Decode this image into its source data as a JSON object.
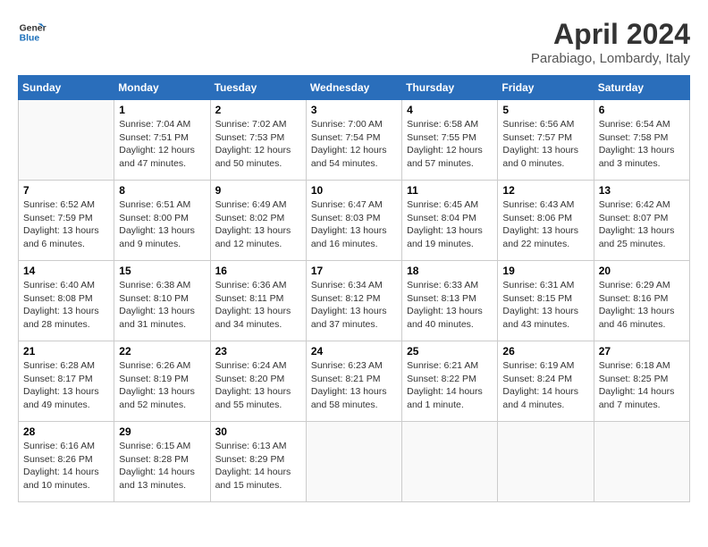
{
  "logo": {
    "line1": "General",
    "line2": "Blue"
  },
  "title": "April 2024",
  "location": "Parabiago, Lombardy, Italy",
  "days_header": [
    "Sunday",
    "Monday",
    "Tuesday",
    "Wednesday",
    "Thursday",
    "Friday",
    "Saturday"
  ],
  "weeks": [
    [
      {
        "day": "",
        "info": ""
      },
      {
        "day": "1",
        "info": "Sunrise: 7:04 AM\nSunset: 7:51 PM\nDaylight: 12 hours\nand 47 minutes."
      },
      {
        "day": "2",
        "info": "Sunrise: 7:02 AM\nSunset: 7:53 PM\nDaylight: 12 hours\nand 50 minutes."
      },
      {
        "day": "3",
        "info": "Sunrise: 7:00 AM\nSunset: 7:54 PM\nDaylight: 12 hours\nand 54 minutes."
      },
      {
        "day": "4",
        "info": "Sunrise: 6:58 AM\nSunset: 7:55 PM\nDaylight: 12 hours\nand 57 minutes."
      },
      {
        "day": "5",
        "info": "Sunrise: 6:56 AM\nSunset: 7:57 PM\nDaylight: 13 hours\nand 0 minutes."
      },
      {
        "day": "6",
        "info": "Sunrise: 6:54 AM\nSunset: 7:58 PM\nDaylight: 13 hours\nand 3 minutes."
      }
    ],
    [
      {
        "day": "7",
        "info": "Sunrise: 6:52 AM\nSunset: 7:59 PM\nDaylight: 13 hours\nand 6 minutes."
      },
      {
        "day": "8",
        "info": "Sunrise: 6:51 AM\nSunset: 8:00 PM\nDaylight: 13 hours\nand 9 minutes."
      },
      {
        "day": "9",
        "info": "Sunrise: 6:49 AM\nSunset: 8:02 PM\nDaylight: 13 hours\nand 12 minutes."
      },
      {
        "day": "10",
        "info": "Sunrise: 6:47 AM\nSunset: 8:03 PM\nDaylight: 13 hours\nand 16 minutes."
      },
      {
        "day": "11",
        "info": "Sunrise: 6:45 AM\nSunset: 8:04 PM\nDaylight: 13 hours\nand 19 minutes."
      },
      {
        "day": "12",
        "info": "Sunrise: 6:43 AM\nSunset: 8:06 PM\nDaylight: 13 hours\nand 22 minutes."
      },
      {
        "day": "13",
        "info": "Sunrise: 6:42 AM\nSunset: 8:07 PM\nDaylight: 13 hours\nand 25 minutes."
      }
    ],
    [
      {
        "day": "14",
        "info": "Sunrise: 6:40 AM\nSunset: 8:08 PM\nDaylight: 13 hours\nand 28 minutes."
      },
      {
        "day": "15",
        "info": "Sunrise: 6:38 AM\nSunset: 8:10 PM\nDaylight: 13 hours\nand 31 minutes."
      },
      {
        "day": "16",
        "info": "Sunrise: 6:36 AM\nSunset: 8:11 PM\nDaylight: 13 hours\nand 34 minutes."
      },
      {
        "day": "17",
        "info": "Sunrise: 6:34 AM\nSunset: 8:12 PM\nDaylight: 13 hours\nand 37 minutes."
      },
      {
        "day": "18",
        "info": "Sunrise: 6:33 AM\nSunset: 8:13 PM\nDaylight: 13 hours\nand 40 minutes."
      },
      {
        "day": "19",
        "info": "Sunrise: 6:31 AM\nSunset: 8:15 PM\nDaylight: 13 hours\nand 43 minutes."
      },
      {
        "day": "20",
        "info": "Sunrise: 6:29 AM\nSunset: 8:16 PM\nDaylight: 13 hours\nand 46 minutes."
      }
    ],
    [
      {
        "day": "21",
        "info": "Sunrise: 6:28 AM\nSunset: 8:17 PM\nDaylight: 13 hours\nand 49 minutes."
      },
      {
        "day": "22",
        "info": "Sunrise: 6:26 AM\nSunset: 8:19 PM\nDaylight: 13 hours\nand 52 minutes."
      },
      {
        "day": "23",
        "info": "Sunrise: 6:24 AM\nSunset: 8:20 PM\nDaylight: 13 hours\nand 55 minutes."
      },
      {
        "day": "24",
        "info": "Sunrise: 6:23 AM\nSunset: 8:21 PM\nDaylight: 13 hours\nand 58 minutes."
      },
      {
        "day": "25",
        "info": "Sunrise: 6:21 AM\nSunset: 8:22 PM\nDaylight: 14 hours\nand 1 minute."
      },
      {
        "day": "26",
        "info": "Sunrise: 6:19 AM\nSunset: 8:24 PM\nDaylight: 14 hours\nand 4 minutes."
      },
      {
        "day": "27",
        "info": "Sunrise: 6:18 AM\nSunset: 8:25 PM\nDaylight: 14 hours\nand 7 minutes."
      }
    ],
    [
      {
        "day": "28",
        "info": "Sunrise: 6:16 AM\nSunset: 8:26 PM\nDaylight: 14 hours\nand 10 minutes."
      },
      {
        "day": "29",
        "info": "Sunrise: 6:15 AM\nSunset: 8:28 PM\nDaylight: 14 hours\nand 13 minutes."
      },
      {
        "day": "30",
        "info": "Sunrise: 6:13 AM\nSunset: 8:29 PM\nDaylight: 14 hours\nand 15 minutes."
      },
      {
        "day": "",
        "info": ""
      },
      {
        "day": "",
        "info": ""
      },
      {
        "day": "",
        "info": ""
      },
      {
        "day": "",
        "info": ""
      }
    ]
  ]
}
